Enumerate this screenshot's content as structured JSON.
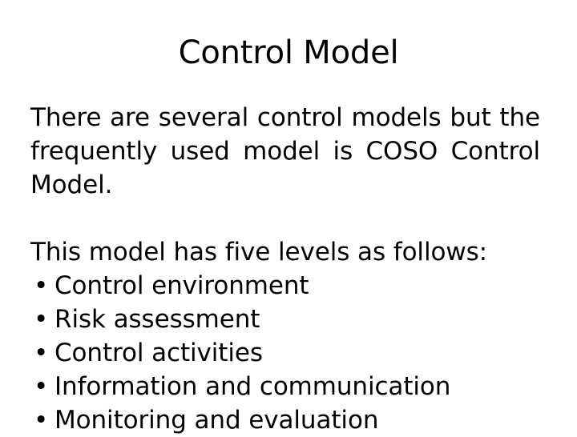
{
  "slide": {
    "title": "Control Model",
    "background_color": "#ffffff",
    "text_color": "#000000",
    "paragraphs": [
      {
        "text": "There are several control models but the frequently used model is COSO Control Model.",
        "align": "justify"
      },
      {
        "text": "This model has five levels as follows:",
        "align": "left"
      }
    ],
    "bullet_marker": "•",
    "bullets": [
      {
        "label": "Control environment"
      },
      {
        "label": "Risk assessment"
      },
      {
        "label": "Control activities"
      },
      {
        "label": "Information and communication"
      },
      {
        "label": "Monitoring and evaluation"
      }
    ]
  }
}
